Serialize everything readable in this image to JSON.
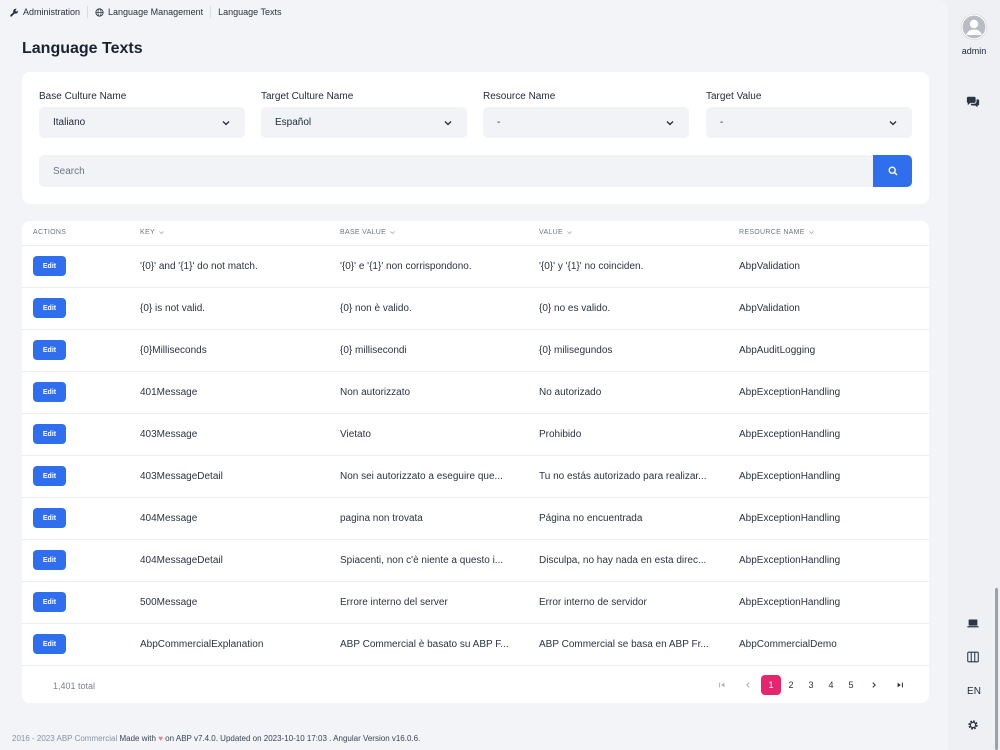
{
  "breadcrumb": [
    {
      "label": "Administration",
      "icon": "wrench-icon"
    },
    {
      "label": "Language Management",
      "icon": "globe-icon"
    },
    {
      "label": "Language Texts"
    }
  ],
  "page_title": "Language Texts",
  "filters": {
    "base_culture": {
      "label": "Base Culture Name",
      "value": "Italiano"
    },
    "target_culture": {
      "label": "Target Culture Name",
      "value": "Español"
    },
    "resource_name": {
      "label": "Resource Name",
      "value": "-"
    },
    "target_value": {
      "label": "Target Value",
      "value": "-"
    },
    "search_placeholder": "Search"
  },
  "table": {
    "columns": [
      "ACTIONS",
      "KEY",
      "BASE VALUE",
      "VALUE",
      "RESOURCE NAME"
    ],
    "edit_label": "Edit",
    "rows": [
      {
        "key": "'{0}' and '{1}' do not match.",
        "base": "'{0}' e '{1}' non corrispondono.",
        "value": "'{0}' y '{1}' no coinciden.",
        "resource": "AbpValidation"
      },
      {
        "key": "{0} is not valid.",
        "base": "{0} non è valido.",
        "value": "{0} no es valido.",
        "resource": "AbpValidation"
      },
      {
        "key": "{0}Milliseconds",
        "base": "{0} millisecondi",
        "value": "{0} milisegundos",
        "resource": "AbpAuditLogging"
      },
      {
        "key": "401Message",
        "base": "Non autorizzato",
        "value": "No autorizado",
        "resource": "AbpExceptionHandling"
      },
      {
        "key": "403Message",
        "base": "Vietato",
        "value": "Prohibido",
        "resource": "AbpExceptionHandling"
      },
      {
        "key": "403MessageDetail",
        "base": "Non sei autorizzato a eseguire que...",
        "value": "Tu no estás autorizado para realizar...",
        "resource": "AbpExceptionHandling"
      },
      {
        "key": "404Message",
        "base": "pagina non trovata",
        "value": "Página no encuentrada",
        "resource": "AbpExceptionHandling"
      },
      {
        "key": "404MessageDetail",
        "base": "Spiacenti, non c'è niente a questo i...",
        "value": "Disculpa, no hay nada en esta direc...",
        "resource": "AbpExceptionHandling"
      },
      {
        "key": "500Message",
        "base": "Errore interno del server",
        "value": "Error interno de servidor",
        "resource": "AbpExceptionHandling"
      },
      {
        "key": "AbpCommercialExplanation",
        "base": "ABP Commercial è basato su ABP F...",
        "value": "ABP Commercial se basa en ABP Fr...",
        "resource": "AbpCommercialDemo"
      }
    ]
  },
  "pagination": {
    "total": "1,401 total",
    "pages": [
      "1",
      "2",
      "3",
      "4",
      "5"
    ],
    "current": "1"
  },
  "footer": {
    "brand": "2016 - 2023 ABP Commercial",
    "made_with": "Made with",
    "heart": "♥",
    "rest": "on ABP v7.4.0. Updated on 2023-10-10 17:03 . Angular Version v16.0.6."
  },
  "user": {
    "name": "admin"
  },
  "language": "EN",
  "colors": {
    "primary": "#2f6fed",
    "active_page": "#e5266f"
  }
}
